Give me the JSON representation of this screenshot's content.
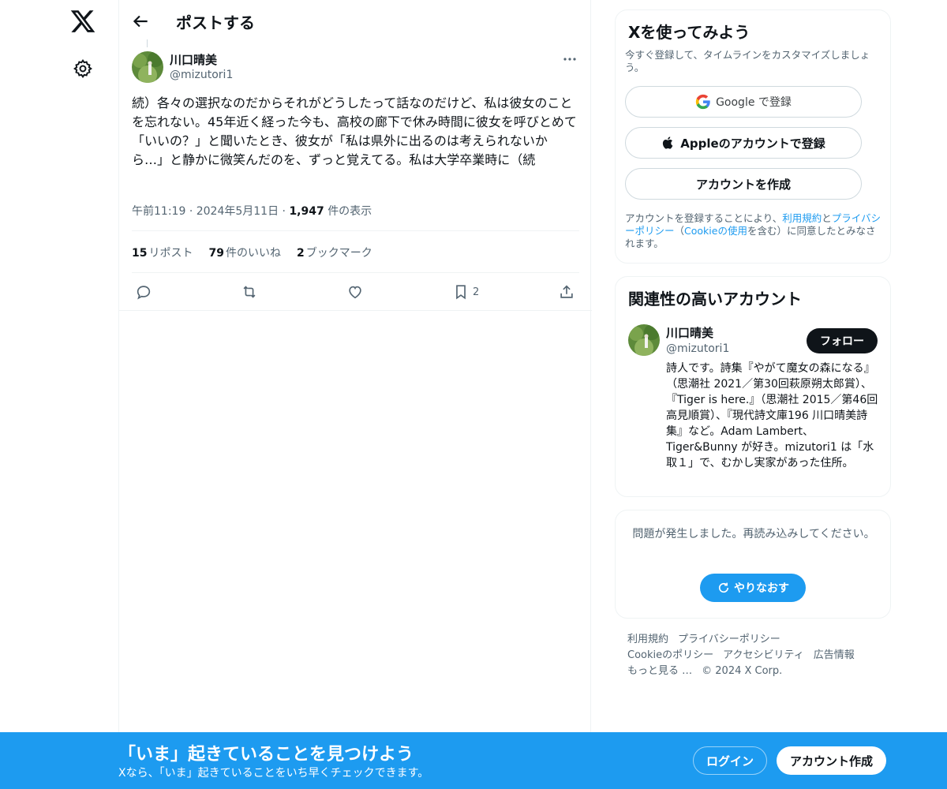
{
  "header": {
    "title": "ポストする"
  },
  "post": {
    "author_name": "川口晴美",
    "author_handle": "@mizutori1",
    "text": "続）各々の選択なのだからそれがどうしたって話なのだけど、私は彼女のことを忘れない。45年近く経った今も、高校の廊下で休み時間に彼女を呼びとめて「いいの？」と聞いたとき、彼女が「私は県外に出るのは考えられないから…」と静かに微笑んだのを、ずっと覚えてる。私は大学卒業時に（続",
    "time": "午前11:19",
    "date": "2024年5月11日",
    "views_count": "1,947",
    "views_label": "件の表示",
    "reposts_count": "15",
    "reposts_label": "リポスト",
    "likes_count": "79",
    "likes_label": "件のいいね",
    "bookmarks_count": "2",
    "bookmarks_label": "ブックマーク",
    "bookmark_action_count": "2"
  },
  "signup": {
    "title": "Xを使ってみよう",
    "subtitle": "今すぐ登録して、タイムラインをカスタマイズしましょう。",
    "google_label": "Google で登録",
    "apple_label": "Appleのアカウントで登録",
    "create_label": "アカウントを作成",
    "terms_prefix": "アカウントを登録することにより、",
    "terms_link": "利用規約",
    "terms_and": "と",
    "privacy_link": "プライバシーポリシー",
    "terms_paren_open": "（",
    "cookie_link": "Cookieの使用",
    "terms_suffix": "を含む）に同意したとみなされます。"
  },
  "relevant": {
    "title": "関連性の高いアカウント",
    "name": "川口晴美",
    "handle": "@mizutori1",
    "follow_label": "フォロー",
    "bio": "詩人です。詩集『やがて魔女の森になる』（思潮社 2021／第30回萩原朔太郎賞）、『Tiger is here.』（思潮社 2015／第46回高見順賞）、『現代詩文庫196 川口晴美詩集』など。Adam Lambert、Tiger&Bunny が好き。mizutori1 は「水取１」で、むかし実家があった住所。"
  },
  "error_card": {
    "message": "問題が発生しました。再読み込みしてください。",
    "retry_label": "やりなおす"
  },
  "footer": {
    "links_row1": [
      "利用規約",
      "プライバシーポリシー"
    ],
    "links_row2": [
      "Cookieのポリシー",
      "アクセシビリティ",
      "広告情報"
    ],
    "more": "もっと見る …",
    "copyright": "© 2024 X Corp."
  },
  "banner": {
    "title": "「いま」起きていることを見つけよう",
    "subtitle": "Xなら、「いま」起きていることをいち早くチェックできます。",
    "login_label": "ログイン",
    "signup_label": "アカウント作成"
  },
  "colors": {
    "accent": "#1d9bf0",
    "text": "#0f1419",
    "secondary": "#536471",
    "border": "#eff3f4"
  },
  "icons": {
    "logo": "x-logo-icon",
    "settings": "gear-icon",
    "back": "back-arrow-icon",
    "more": "more-dots-icon",
    "reply": "reply-icon",
    "repost": "repost-icon",
    "like": "heart-icon",
    "bookmark": "bookmark-icon",
    "share": "share-icon",
    "google": "google-icon",
    "apple": "apple-icon",
    "refresh": "refresh-icon"
  }
}
